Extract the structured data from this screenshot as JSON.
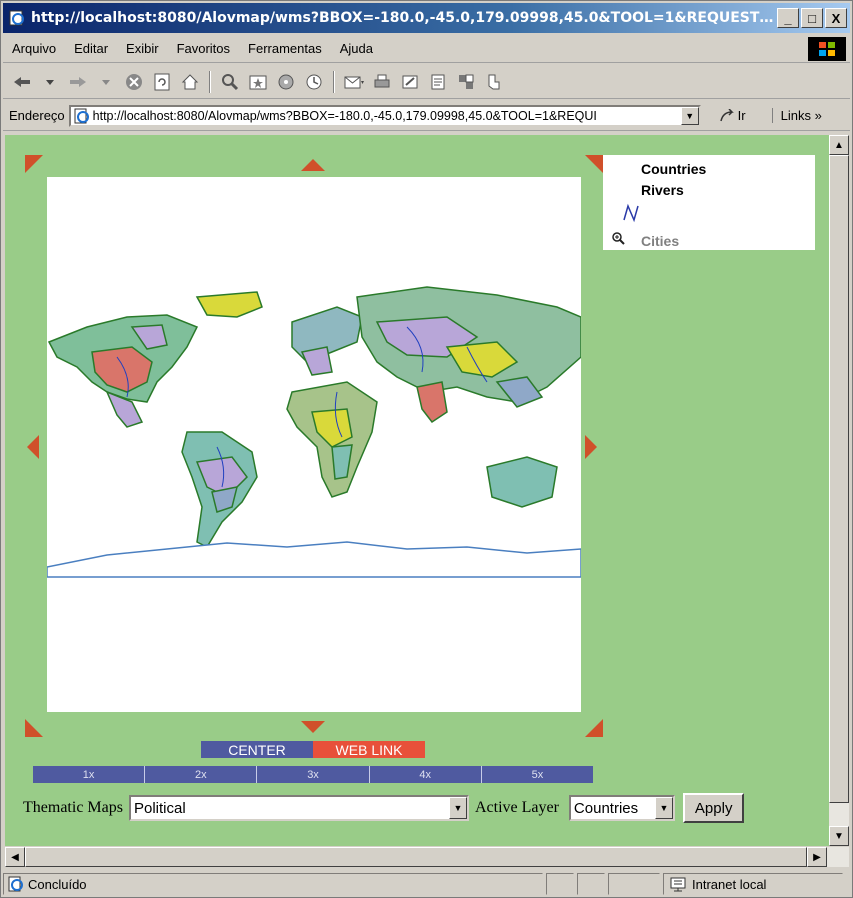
{
  "window": {
    "title": "http://localhost:8080/Alovmap/wms?BBOX=-180.0,-45.0,179.09998,45.0&TOOL=1&REQUEST=Ge...",
    "minimize": "_",
    "maximize": "□",
    "close": "X"
  },
  "menu": {
    "items": [
      "Arquivo",
      "Editar",
      "Exibir",
      "Favoritos",
      "Ferramentas",
      "Ajuda"
    ]
  },
  "address": {
    "label": "Endereço",
    "url": "http://localhost:8080/Alovmap/wms?BBOX=-180.0,-45.0,179.09998,45.0&TOOL=1&REQUI",
    "go_label": "Ir",
    "links_label": "Links »"
  },
  "legend": {
    "countries": "Countries",
    "rivers": "Rivers",
    "cities": "Cities"
  },
  "controls": {
    "center_label": "CENTER",
    "weblink_label": "WEB LINK",
    "zoom_levels": [
      "1x",
      "2x",
      "3x",
      "4x",
      "5x"
    ],
    "thematic_label": "Thematic Maps",
    "thematic_value": "Political",
    "active_layer_label": "Active Layer",
    "active_layer_value": "Countries",
    "apply_label": "Apply"
  },
  "status": {
    "text": "Concluído",
    "zone": "Intranet local"
  },
  "colors": {
    "page_background": "#99cc88",
    "center_button": "#4f5aa0",
    "weblink_button": "#e8503a",
    "arrow": "#d0502a"
  }
}
